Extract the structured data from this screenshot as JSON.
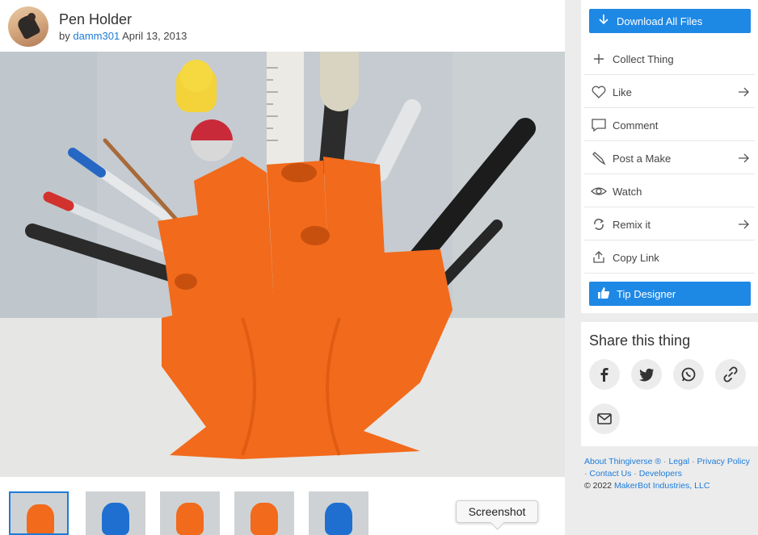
{
  "thing": {
    "title": "Pen Holder",
    "by_prefix": "by",
    "author": "damm301",
    "date": "April 13, 2013"
  },
  "gallery": {
    "tooltip": "Screenshot",
    "thumbs": [
      {
        "selected": true,
        "color": "#f26a1b"
      },
      {
        "selected": false,
        "color": "#1f6fd1"
      },
      {
        "selected": false,
        "color": "#f26a1b"
      },
      {
        "selected": false,
        "color": "#f26a1b"
      },
      {
        "selected": false,
        "color": "#1f6fd1"
      }
    ]
  },
  "actions": {
    "download": "Download All Files",
    "collect": "Collect Thing",
    "like": "Like",
    "comment": "Comment",
    "post_make": "Post a Make",
    "watch": "Watch",
    "remix": "Remix it",
    "copy_link": "Copy Link",
    "tip": "Tip Designer"
  },
  "share": {
    "title": "Share this thing",
    "buttons": [
      "facebook-icon",
      "twitter-icon",
      "whatsapp-icon",
      "link-icon",
      "email-icon"
    ]
  },
  "footer": {
    "about": "About Thingiverse ®",
    "legal": "Legal",
    "privacy": "Privacy Policy",
    "contact": "Contact Us",
    "developers": "Developers",
    "copyright": "©  2022",
    "company": "MakerBot Industries, LLC",
    "separator": "·"
  },
  "colors": {
    "accent": "#1e88e5",
    "link": "#1d7bd8",
    "print_orange": "#f26a1b",
    "print_blue": "#1f6fd1"
  }
}
